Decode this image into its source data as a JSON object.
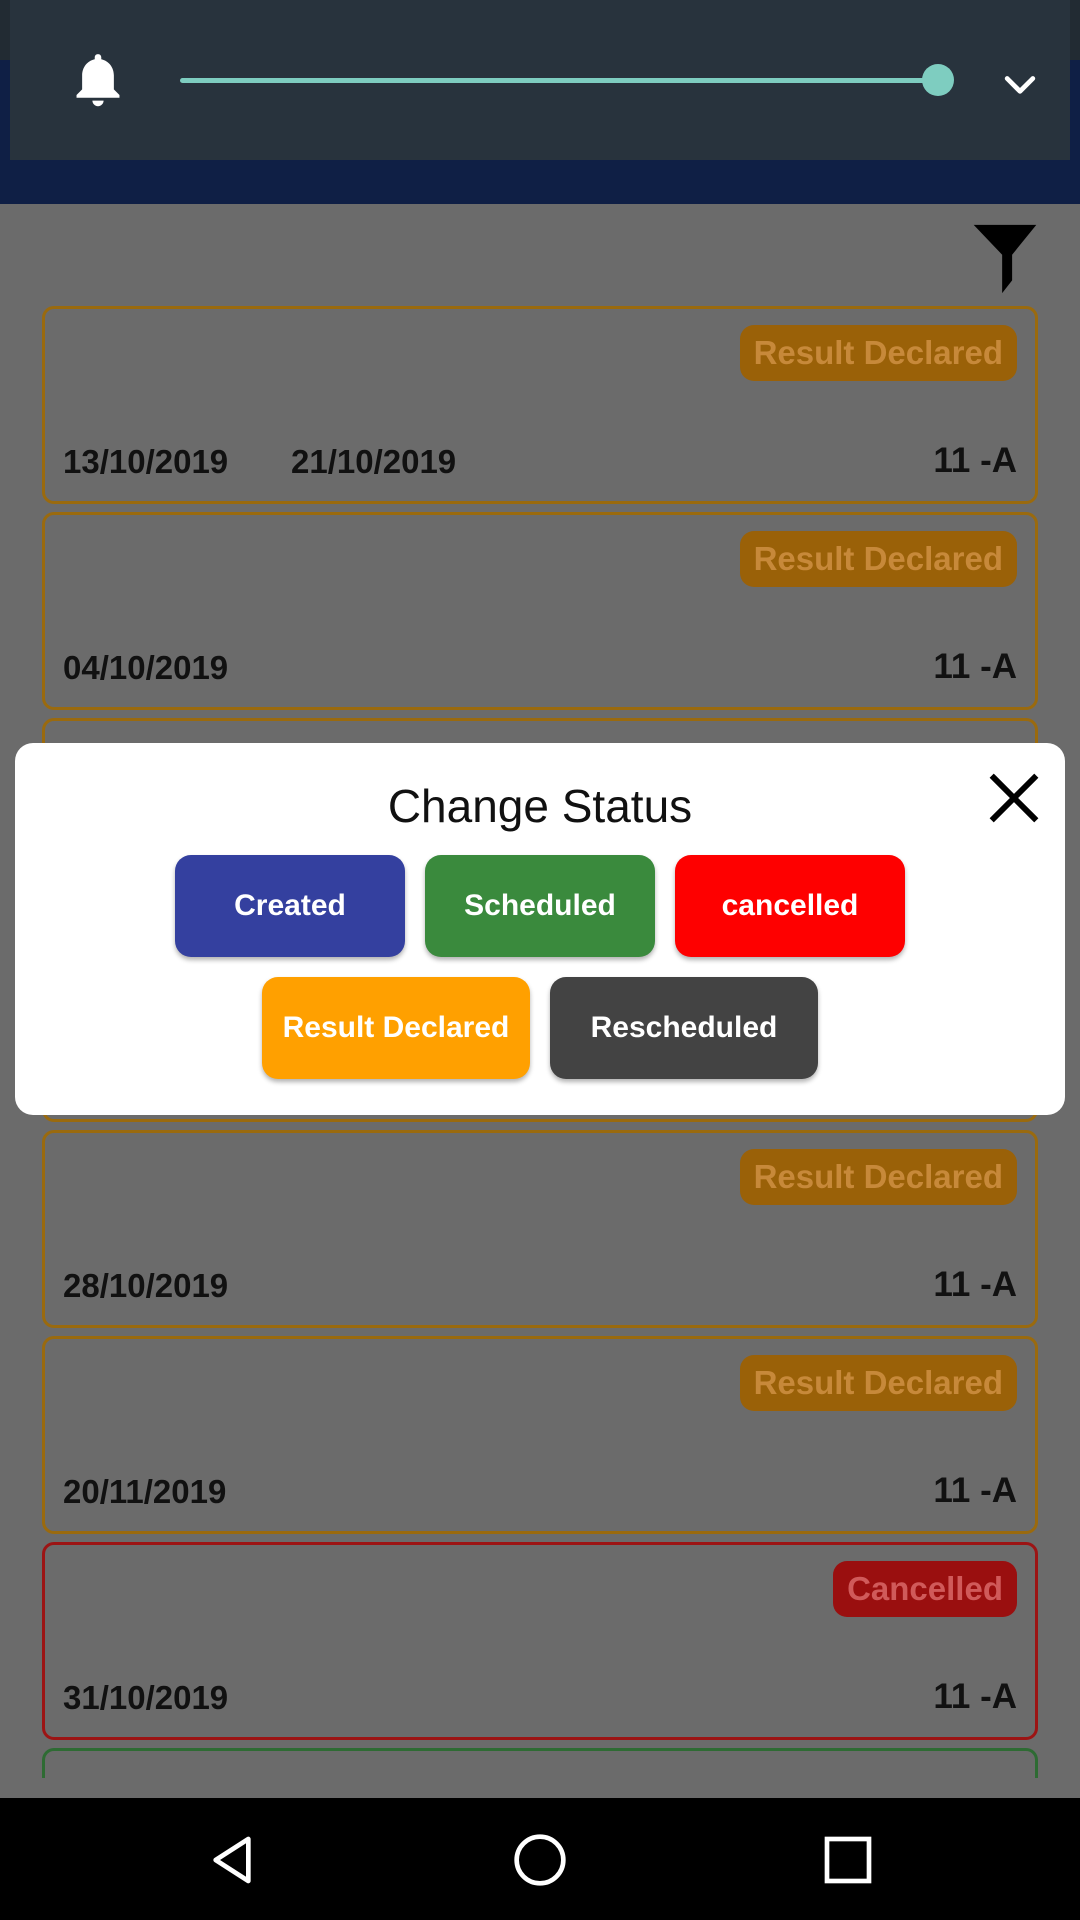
{
  "notification": {
    "brightness_level": 0.97
  },
  "list": {
    "cards": [
      {
        "status": "Result Declared",
        "date_start": "13/10/2019",
        "date_end": "21/10/2019",
        "section": "11 -A"
      },
      {
        "status": "Result Declared",
        "date_start": "04/10/2019",
        "date_end": "",
        "section": "11 -A"
      },
      {
        "status": "Result Declared",
        "date_start": "28/10/2019",
        "date_end": "",
        "section": "11 -A"
      },
      {
        "status": "Result Declared",
        "date_start": "20/11/2019",
        "date_end": "",
        "section": "11 -A"
      },
      {
        "status": "Cancelled",
        "date_start": "31/10/2019",
        "date_end": "",
        "section": "11 -A"
      }
    ]
  },
  "dialog": {
    "title": "Change Status",
    "buttons": {
      "created": "Created",
      "scheduled": "Scheduled",
      "cancelled": "cancelled",
      "result_declared": "Result Declared",
      "rescheduled": "Rescheduled"
    }
  },
  "colors": {
    "created": "#34409f",
    "scheduled": "#3a8a3d",
    "cancelled": "#fe0000",
    "result_declared": "#ffa000",
    "rescheduled": "#434343",
    "slider": "#7ecdc0"
  },
  "icons": [
    "bell-icon",
    "chevron-down-icon",
    "filter-icon",
    "close-icon",
    "back-icon",
    "home-icon",
    "recent-apps-icon"
  ]
}
